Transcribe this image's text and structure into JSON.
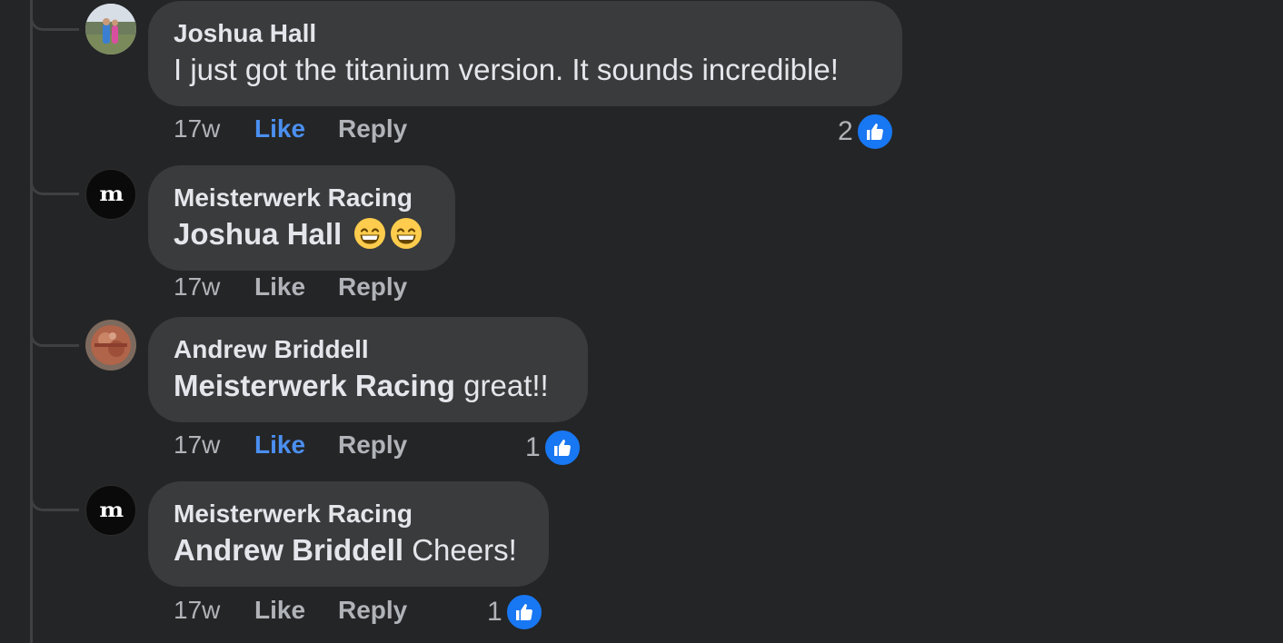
{
  "comments": [
    {
      "author": "Joshua Hall",
      "mention": "",
      "text": "I just got the titanium version. It sounds incredible!",
      "time": "17w",
      "like_label": "Like",
      "reply_label": "Reply",
      "liked": true,
      "reaction_count": "2"
    },
    {
      "author": "Meisterwerk Racing",
      "mention": "Joshua Hall",
      "text": "",
      "emojis": [
        "grinning-face-with-smiling-eyes",
        "grinning-face-with-smiling-eyes"
      ],
      "time": "17w",
      "like_label": "Like",
      "reply_label": "Reply",
      "liked": false,
      "reaction_count": ""
    },
    {
      "author": "Andrew Briddell",
      "mention": "Meisterwerk Racing",
      "text": "great!!",
      "time": "17w",
      "like_label": "Like",
      "reply_label": "Reply",
      "liked": true,
      "reaction_count": "1"
    },
    {
      "author": "Meisterwerk Racing",
      "mention": "Andrew Briddell",
      "text": "Cheers!",
      "time": "17w",
      "like_label": "Like",
      "reply_label": "Reply",
      "liked": false,
      "reaction_count": "1"
    }
  ],
  "brand_avatar_text": "m",
  "colors": {
    "background": "#242526",
    "bubble": "#3a3b3c",
    "primary_text": "#e4e6eb",
    "secondary_text": "#b0b3b8",
    "like_active": "#4b8ff0",
    "reaction_badge": "#1877f2"
  },
  "icons": {
    "reaction": "thumbs-up-icon",
    "emoji": "grinning-face-icon"
  }
}
